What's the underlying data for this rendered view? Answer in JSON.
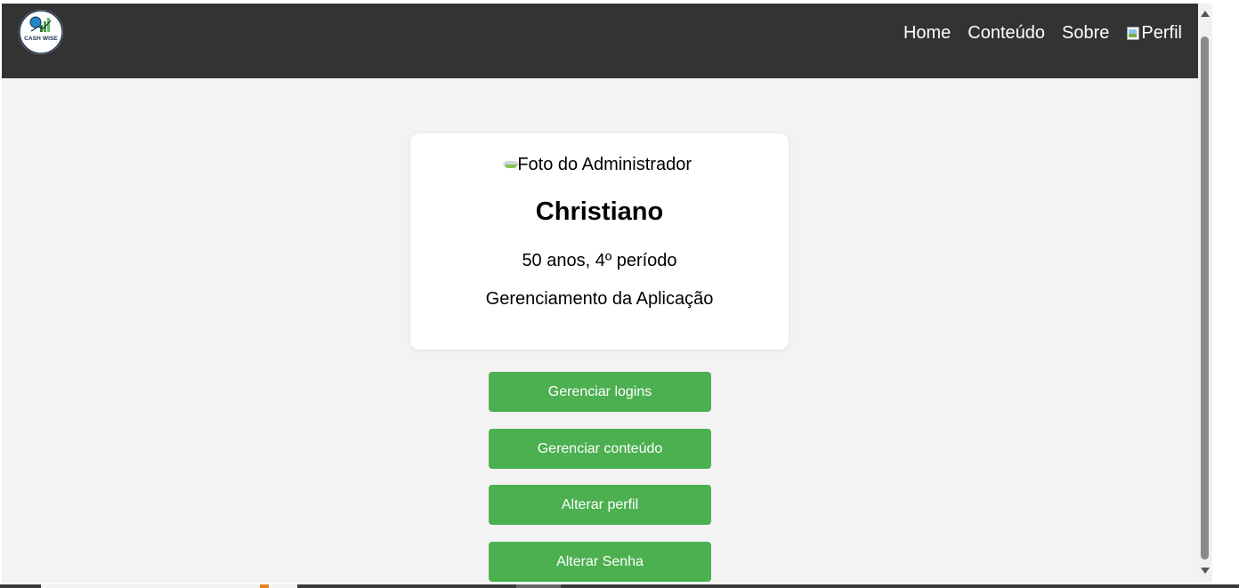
{
  "navbar": {
    "logo_text": "CASH WISE",
    "links": [
      "Home",
      "Conteúdo",
      "Sobre"
    ],
    "profile_alt": "Perfil"
  },
  "profile_card": {
    "photo_alt": "Foto do Administrador",
    "name": "Christiano",
    "info": "50 anos, 4º período",
    "role": "Gerenciamento da Aplicação"
  },
  "actions": {
    "manage_logins": "Gerenciar logins",
    "manage_content": "Gerenciar conteúdo",
    "edit_profile": "Alterar perfil",
    "change_password": "Alterar Senha"
  },
  "colors": {
    "navbar_bg": "#333333",
    "page_bg": "#f3f3f3",
    "button_bg": "#4caf50",
    "card_bg": "#ffffff"
  },
  "icons": {
    "logo": "cash-wise-logo",
    "broken_image": "broken-image-icon"
  }
}
